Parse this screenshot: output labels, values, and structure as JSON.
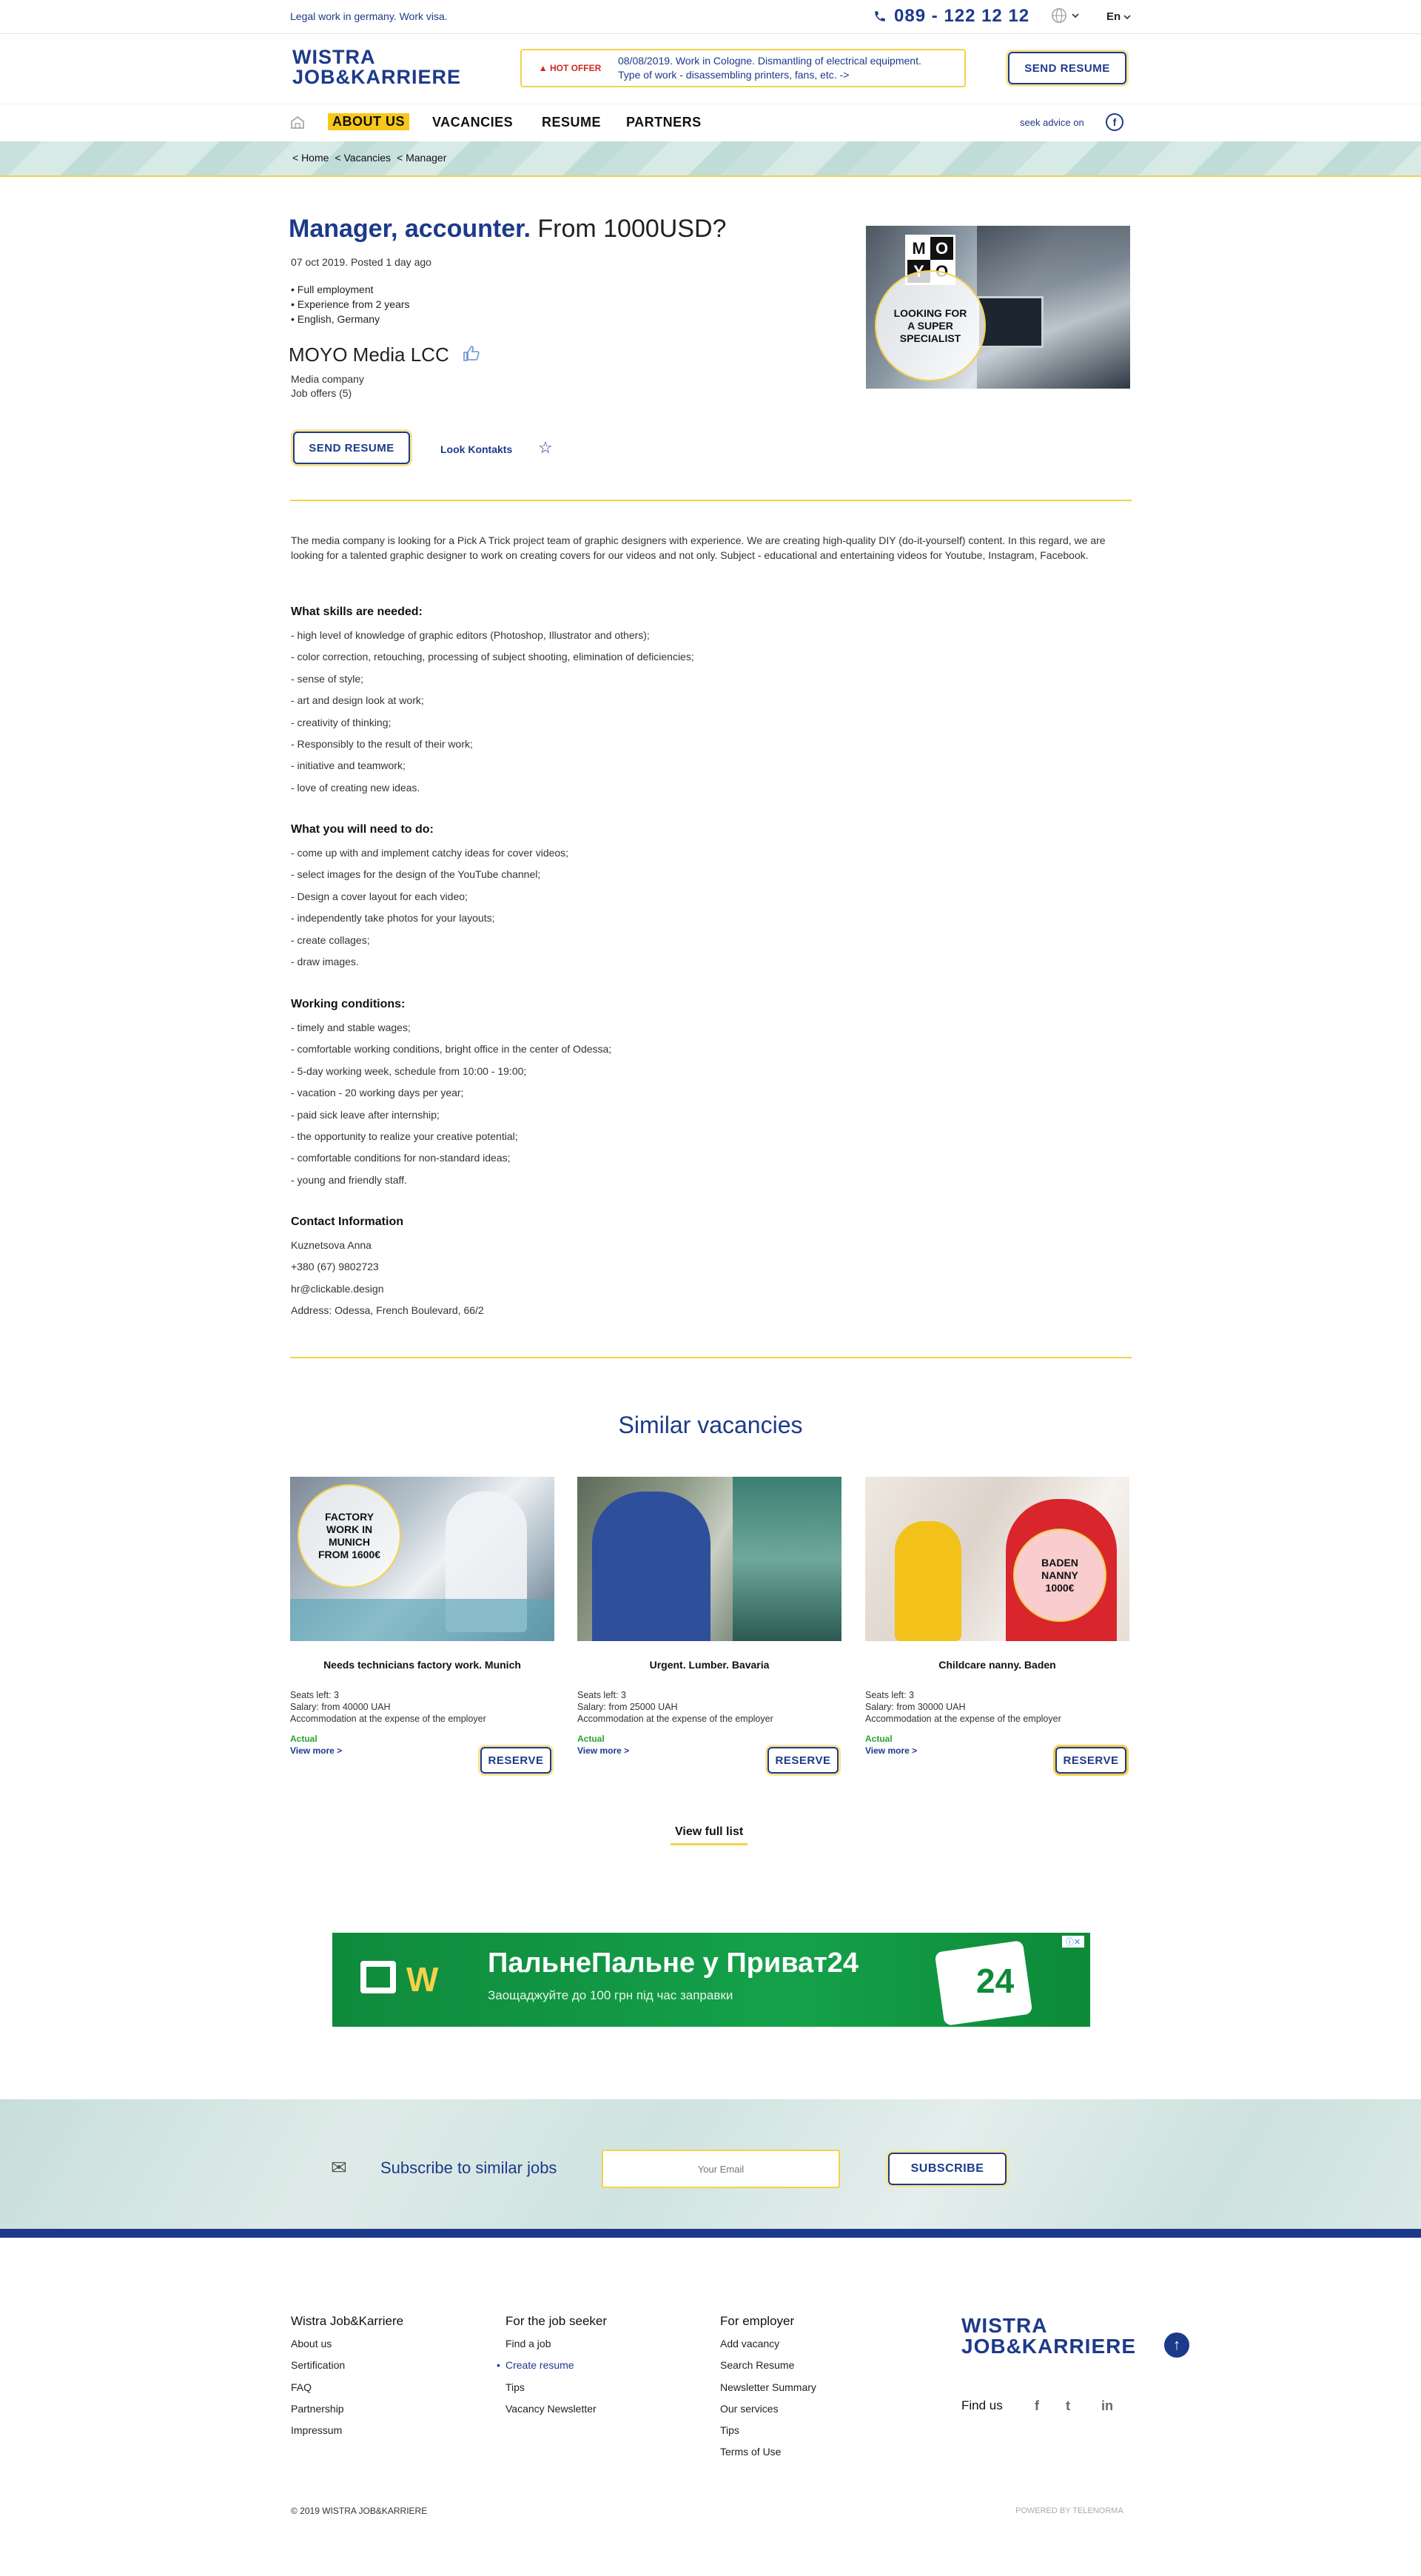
{
  "topbar": {
    "legal": "Legal work in germany. Work visa.",
    "phone": "089 - 122 12 12",
    "lang": "En"
  },
  "header": {
    "logo_line1": "WISTRA",
    "logo_line2": "JOB&KARRIERE",
    "hot_label": "HOT OFFER",
    "hot_text_line1": "08/08/2019. Work in Cologne. Dismantling of electrical equipment.",
    "hot_text_line2": "Type of work - disassembling printers, fans, etc.  ->",
    "send_resume": "SEND RESUME"
  },
  "nav": {
    "items": [
      "ABOUT US",
      "VACANCIES",
      "RESUME",
      "PARTNERS"
    ],
    "seek": "seek advice on",
    "fb": "f"
  },
  "breadcrumb": [
    "< Home",
    "< Vacancies",
    "< Manager"
  ],
  "job": {
    "title_highlight": "Manager, accounter.",
    "title_rest": " From 1000USD?",
    "posted": "07 oct 2019. Posted 1 day ago",
    "features": [
      "Full employment",
      "Experience from 2 years",
      "English, Germany"
    ],
    "company": "MOYO Media LCC",
    "company_type": "Media company",
    "job_offers": "Job offers (5)",
    "image_badge": "LOOKING FOR A SUPER SPECIALIST",
    "brand_letters": [
      "M",
      "O",
      "Y",
      "O"
    ],
    "send_resume": "SEND RESUME",
    "look_contacts": "Look Kontakts"
  },
  "description": "The media company is looking for a Pick A Trick project team of graphic designers with experience. We are creating high-quality DIY (do-it-yourself) content. In this regard, we are looking for a talented graphic designer to work on creating covers for our videos and not only. Subject - educational and entertaining videos for Youtube, Instagram, Facebook.",
  "sections": {
    "skills": {
      "title": "What skills are needed:",
      "items": [
        "- high level of knowledge of graphic editors (Photoshop, Illustrator and others);",
        "- color correction, retouching, processing of subject shooting, elimination of deficiencies;",
        "- sense of style;",
        "- art and design look at work;",
        "- creativity of thinking;",
        "- Responsibly to the result of their work;",
        "- initiative and teamwork;",
        "- love of creating new ideas."
      ]
    },
    "todo": {
      "title": "What you will need to do:",
      "items": [
        "- come up with and implement catchy ideas for cover videos;",
        "- select images for the design of the YouTube channel;",
        "- Design a cover layout for each video;",
        "- independently take photos for your layouts;",
        "- create collages;",
        "- draw images."
      ]
    },
    "conditions": {
      "title": "Working conditions:",
      "items": [
        "- timely and stable wages;",
        "- comfortable working conditions, bright office in the center of Odessa;",
        "- 5-day working week, schedule from 10:00 - 19:00;",
        "- vacation - 20 working days per year;",
        "- paid sick leave after internship;",
        "- the opportunity to realize your creative potential;",
        "- comfortable conditions for non-standard ideas;",
        "- young and friendly staff."
      ]
    },
    "contact": {
      "title": "Contact Information",
      "items": [
        "Kuznetsova Anna",
        "+380 (67) 9802723",
        "hr@clickable.design",
        "Address: Odessa, French Boulevard, 66/2"
      ]
    }
  },
  "similar": {
    "title": "Similar vacancies",
    "cards": [
      {
        "title": "Needs technicians factory work. Munich",
        "badge": "FACTORY WORK IN MUNICH FROM 1600€",
        "seats": "Seats left: 3",
        "salary": "Salary: from 40000 UAH",
        "accommodation": "Accommodation at the expense of the employer",
        "status": "Actual",
        "more": "View more >",
        "reserve": "RESERVE"
      },
      {
        "title": "Urgent. Lumber. Bavaria",
        "badge": "",
        "seats": "Seats left: 3",
        "salary": "Salary: from 25000 UAH",
        "accommodation": "Accommodation at the expense of the employer",
        "status": "Actual",
        "more": "View more >",
        "reserve": "RESERVE"
      },
      {
        "title": "Childcare nanny. Baden",
        "badge": "BADEN NANNY 1000€",
        "seats": "Seats left: 3",
        "salary": "Salary: from 30000 UAH",
        "accommodation": "Accommodation at the expense of the employer",
        "status": "Actual",
        "more": "View more >",
        "reserve": "RESERVE"
      }
    ],
    "view_full": "View full list"
  },
  "ad": {
    "headline": "ПальнеПальне у Приват24",
    "sub": "Заощаджуйте до 100 грн під час заправки",
    "num": "24"
  },
  "subscribe": {
    "label": "Subscribe to similar jobs",
    "placeholder": "Your Email",
    "button": "SUBSCRIBE"
  },
  "footer": {
    "col1": {
      "title": "Wistra Job&Karriere",
      "links": [
        "About us",
        "Sertification",
        "FAQ",
        "Partnership",
        "Impressum"
      ]
    },
    "col2": {
      "title": "For the job seeker",
      "links": [
        "Find a job",
        "Create resume",
        "Tips",
        "Vacancy Newsletter"
      ]
    },
    "col3": {
      "title": "For employer",
      "links": [
        "Add vacancy",
        "Search Resume",
        "Newsletter Summary",
        "Our services",
        "Tips",
        "Terms of Use"
      ]
    },
    "find_us": "Find us",
    "social": [
      "f",
      "t",
      "in"
    ],
    "copyright": "© 2019 WISTRA JOB&KARRIERE",
    "powered": "POWERED BY TELENORMA"
  },
  "colors": {
    "navy": "#1d3a8a",
    "yellow": "#f3d24c",
    "green": "#2fa12f",
    "hot_red": "#d0281e"
  }
}
